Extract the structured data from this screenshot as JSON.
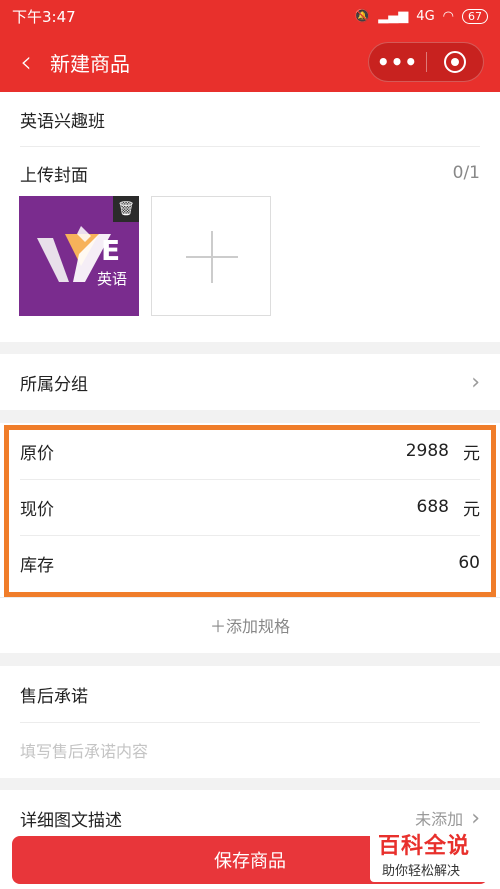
{
  "status_bar": {
    "time": "下午3:47",
    "network": "4G",
    "battery": "67"
  },
  "nav": {
    "title": "新建商品",
    "more_icon": "•••"
  },
  "product_name": "英语兴趣班",
  "cover": {
    "label": "上传封面",
    "count": "0/1",
    "thumb_letter": "E",
    "thumb_text": "英语"
  },
  "group": {
    "label": "所属分组"
  },
  "pricing": {
    "original_label": "原价",
    "original_value": "2988",
    "original_unit": "元",
    "current_label": "现价",
    "current_value": "688",
    "current_unit": "元",
    "stock_label": "库存",
    "stock_value": "60"
  },
  "add_spec": "＋添加规格",
  "after_sale": {
    "label": "售后承诺",
    "placeholder": "填写售后承诺内容"
  },
  "detail": {
    "label": "详细图文描述",
    "status": "未添加"
  },
  "save_button": "保存商品",
  "watermark": {
    "main": "百科全说",
    "sub": "助你轻松解决"
  },
  "colors": {
    "brand_red": "#e8302c",
    "highlight_orange": "#f07d2a",
    "cover_purple": "#7a2c8e"
  }
}
